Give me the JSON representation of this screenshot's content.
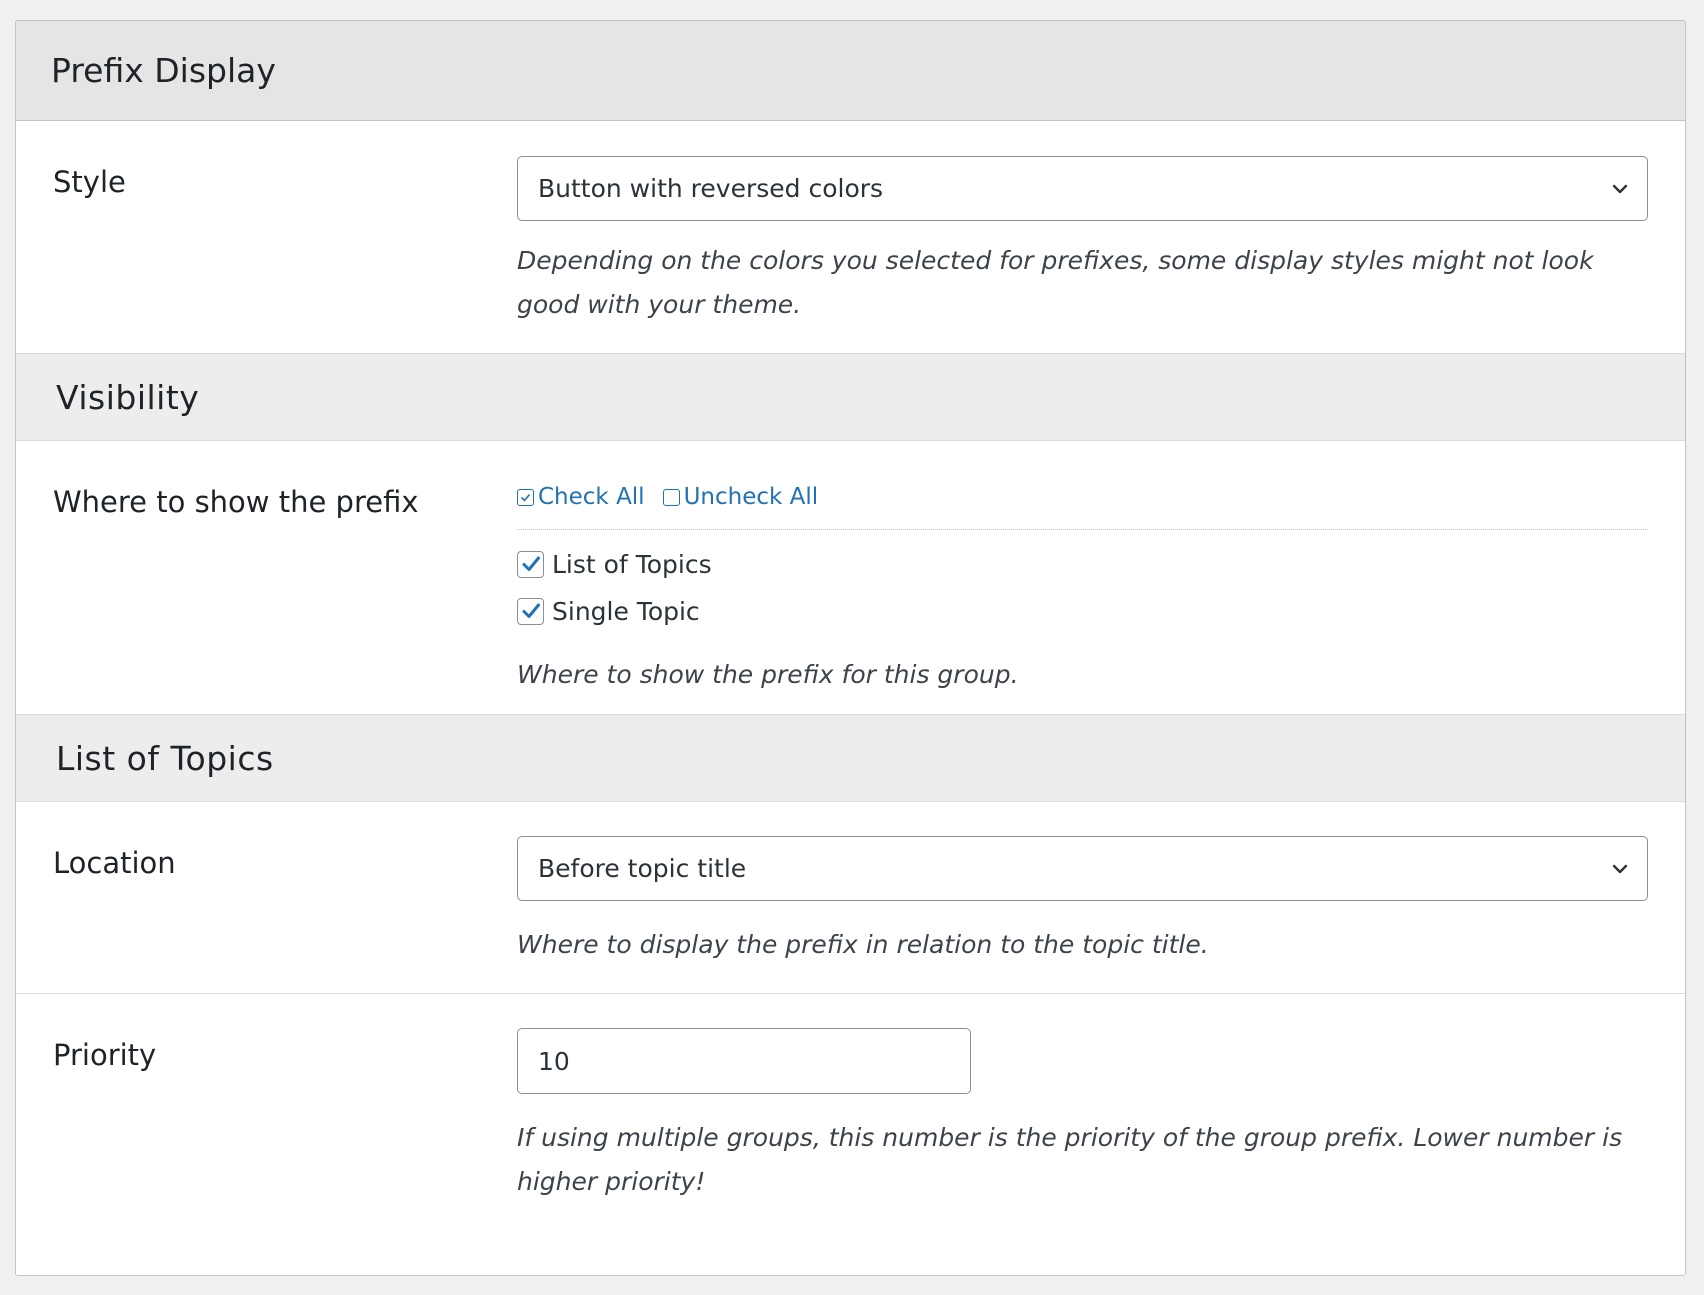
{
  "panel": {
    "title": "Prefix Display"
  },
  "style_row": {
    "label": "Style",
    "selected": "Button with reversed colors",
    "description": "Depending on the colors you selected for prefixes, some display styles might not look good with your theme."
  },
  "visibility": {
    "section_title": "Visibility",
    "label": "Where to show the prefix",
    "check_all": "Check All",
    "uncheck_all": "Uncheck All",
    "options": [
      {
        "label": "List of Topics",
        "checked": true
      },
      {
        "label": "Single Topic",
        "checked": true
      }
    ],
    "description": "Where to show the prefix for this group."
  },
  "list_of_topics": {
    "section_title": "List of Topics",
    "location": {
      "label": "Location",
      "selected": "Before topic title",
      "description": "Where to display the prefix in relation to the topic title."
    },
    "priority": {
      "label": "Priority",
      "value": "10",
      "description": "If using multiple groups, this number is the priority of the group prefix. Lower number is higher priority!"
    }
  },
  "colors": {
    "accent": "#2271b1",
    "header_bg": "#e5e5e5",
    "section_bg": "#ededed"
  },
  "icons": [
    "chevron-down-icon",
    "check-all-icon",
    "uncheck-all-icon",
    "checkmark-icon"
  ]
}
